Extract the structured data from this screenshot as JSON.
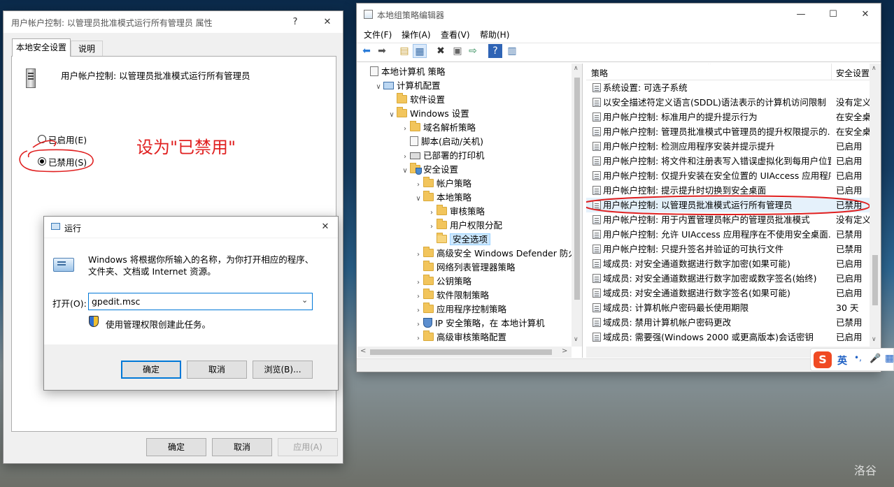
{
  "props": {
    "title": "用户帐户控制: 以管理员批准模式运行所有管理员 属性",
    "help_label": "?",
    "close_label": "✕",
    "tabs": [
      "本地安全设置",
      "说明"
    ],
    "policy_name": "用户帐户控制: 以管理员批准模式运行所有管理员",
    "radio_enabled": "已启用(E)",
    "radio_disabled": "已禁用(S)",
    "annotation": "设为\"已禁用\"",
    "ok": "确定",
    "cancel": "取消",
    "apply": "应用(A)"
  },
  "run": {
    "title": "运行",
    "description": "Windows 将根据你所输入的名称，为你打开相应的程序、文件夹、文档或 Internet 资源。",
    "open_label": "打开(O):",
    "open_value": "gpedit.msc",
    "admin_note": "使用管理权限创建此任务。",
    "ok": "确定",
    "cancel": "取消",
    "browse": "浏览(B)..."
  },
  "gpedit": {
    "title": "本地组策略编辑器",
    "menu": [
      "文件(F)",
      "操作(A)",
      "查看(V)",
      "帮助(H)"
    ],
    "tree": [
      {
        "label": "本地计算机 策略",
        "level": 0,
        "exp": "",
        "icon": "doc"
      },
      {
        "label": "计算机配置",
        "level": 1,
        "exp": "v",
        "icon": "computer"
      },
      {
        "label": "软件设置",
        "level": 2,
        "exp": "",
        "icon": "folder"
      },
      {
        "label": "Windows 设置",
        "level": 2,
        "exp": "v",
        "icon": "folder"
      },
      {
        "label": "域名解析策略",
        "level": 3,
        "exp": ">",
        "icon": "folder"
      },
      {
        "label": "脚本(启动/关机)",
        "level": 3,
        "exp": "",
        "icon": "doc"
      },
      {
        "label": "已部署的打印机",
        "level": 3,
        "exp": ">",
        "icon": "printer"
      },
      {
        "label": "安全设置",
        "level": 3,
        "exp": "v",
        "icon": "shield"
      },
      {
        "label": "帐户策略",
        "level": 4,
        "exp": ">",
        "icon": "folder"
      },
      {
        "label": "本地策略",
        "level": 4,
        "exp": "v",
        "icon": "folder"
      },
      {
        "label": "审核策略",
        "level": 5,
        "exp": ">",
        "icon": "folder"
      },
      {
        "label": "用户权限分配",
        "level": 5,
        "exp": ">",
        "icon": "folder"
      },
      {
        "label": "安全选项",
        "level": 5,
        "exp": "",
        "icon": "folder",
        "selected": true
      },
      {
        "label": "高级安全 Windows Defender 防火墙",
        "level": 4,
        "exp": ">",
        "icon": "folder"
      },
      {
        "label": "网络列表管理器策略",
        "level": 4,
        "exp": "",
        "icon": "folder"
      },
      {
        "label": "公钥策略",
        "level": 4,
        "exp": ">",
        "icon": "folder"
      },
      {
        "label": "软件限制策略",
        "level": 4,
        "exp": ">",
        "icon": "folder"
      },
      {
        "label": "应用程序控制策略",
        "level": 4,
        "exp": ">",
        "icon": "folder"
      },
      {
        "label": "IP 安全策略，在 本地计算机",
        "level": 4,
        "exp": ">",
        "icon": "ipsec"
      },
      {
        "label": "高级审核策略配置",
        "level": 4,
        "exp": ">",
        "icon": "folder"
      }
    ],
    "columns": {
      "policy": "策略",
      "setting": "安全设置"
    },
    "policies": [
      {
        "name": "系统设置: 可选子系统",
        "setting": ""
      },
      {
        "name": "以安全描述符定义语言(SDDL)语法表示的计算机访问限制",
        "setting": "没有定义"
      },
      {
        "name": "用户帐户控制: 标准用户的提升提示行为",
        "setting": "在安全桌面"
      },
      {
        "name": "用户帐户控制: 管理员批准模式中管理员的提升权限提示的...",
        "setting": "在安全桌面"
      },
      {
        "name": "用户帐户控制: 检测应用程序安装并提示提升",
        "setting": "已启用"
      },
      {
        "name": "用户帐户控制: 将文件和注册表写入错误虚拟化到每用户位置",
        "setting": "已启用"
      },
      {
        "name": "用户帐户控制: 仅提升安装在安全位置的 UIAccess 应用程序",
        "setting": "已启用"
      },
      {
        "name": "用户帐户控制: 提示提升时切换到安全桌面",
        "setting": "已启用"
      },
      {
        "name": "用户帐户控制: 以管理员批准模式运行所有管理员",
        "setting": "已禁用",
        "highlight": true
      },
      {
        "name": "用户帐户控制: 用于内置管理员帐户的管理员批准模式",
        "setting": "没有定义"
      },
      {
        "name": "用户帐户控制: 允许 UIAccess 应用程序在不使用安全桌面...",
        "setting": "已禁用"
      },
      {
        "name": "用户帐户控制: 只提升签名并验证的可执行文件",
        "setting": "已禁用"
      },
      {
        "name": "域成员: 对安全通道数据进行数字加密(如果可能)",
        "setting": "已启用"
      },
      {
        "name": "域成员: 对安全通道数据进行数字加密或数字签名(始终)",
        "setting": "已启用"
      },
      {
        "name": "域成员: 对安全通道数据进行数字签名(如果可能)",
        "setting": "已启用"
      },
      {
        "name": "域成员: 计算机帐户密码最长使用期限",
        "setting": "30 天"
      },
      {
        "name": "域成员: 禁用计算机帐户密码更改",
        "setting": "已禁用"
      },
      {
        "name": "域成员: 需要强(Windows 2000 或更高版本)会话密钥",
        "setting": "已启用"
      }
    ]
  },
  "ime": {
    "logo": "S",
    "lang": "英",
    "punct": "•,",
    "mic": "🎤",
    "grid": "▦"
  },
  "watermark": "洛谷",
  "colors": {
    "accent": "#0078d7",
    "selection": "#cce8ff",
    "annotation_red": "#e02020"
  }
}
